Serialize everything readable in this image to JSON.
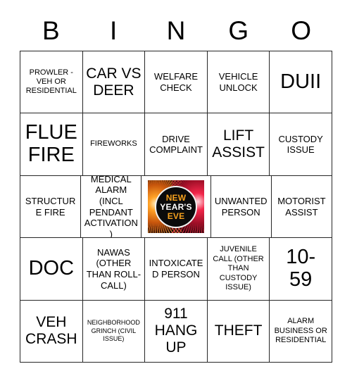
{
  "card": {
    "header_letters": [
      "B",
      "I",
      "N",
      "G",
      "O"
    ],
    "rows": [
      [
        {
          "text": "PROWLER - VEH OR RESIDENTIAL",
          "size": "sm",
          "type": "text"
        },
        {
          "text": "CAR VS DEER",
          "size": "lg",
          "type": "text"
        },
        {
          "text": "WELFARE CHECK",
          "size": "md",
          "type": "text"
        },
        {
          "text": "VEHICLE UNLOCK",
          "size": "md",
          "type": "text"
        },
        {
          "text": "DUII",
          "size": "xl",
          "type": "text"
        }
      ],
      [
        {
          "text": "FLUE FIRE",
          "size": "xl",
          "type": "text"
        },
        {
          "text": "FIREWORKS",
          "size": "sm",
          "type": "text"
        },
        {
          "text": "DRIVE COMPLAINT",
          "size": "md",
          "type": "text"
        },
        {
          "text": "LIFT ASSIST",
          "size": "lg",
          "type": "text"
        },
        {
          "text": "CUSTODY ISSUE",
          "size": "md",
          "type": "text"
        }
      ],
      [
        {
          "text": "STRUCTURE FIRE",
          "size": "md",
          "type": "text"
        },
        {
          "text": "MEDICAL ALARM (INCL PENDANT ACTIVATION)",
          "size": "md",
          "type": "text"
        },
        {
          "text": "",
          "size": "md",
          "type": "free_image"
        },
        {
          "text": "UNWANTED PERSON",
          "size": "md",
          "type": "text"
        },
        {
          "text": "MOTORIST ASSIST",
          "size": "md",
          "type": "text"
        }
      ],
      [
        {
          "text": "DOC",
          "size": "xl",
          "type": "text"
        },
        {
          "text": "NAWAS (OTHER THAN ROLL-CALL)",
          "size": "md",
          "type": "text"
        },
        {
          "text": "INTOXICATED PERSON",
          "size": "md",
          "type": "text"
        },
        {
          "text": "JUVENILE CALL (OTHER THAN CUSTODY ISSUE)",
          "size": "sm",
          "type": "text"
        },
        {
          "text": "10- 59",
          "size": "xl",
          "type": "text"
        }
      ],
      [
        {
          "text": "VEH CRASH",
          "size": "lg",
          "type": "text"
        },
        {
          "text": "NEIGHBORHOOD GRINCH (CIVIL ISSUE)",
          "size": "xs",
          "type": "text"
        },
        {
          "text": "911 HANG UP",
          "size": "lg",
          "type": "text"
        },
        {
          "text": "THEFT",
          "size": "lg",
          "type": "text"
        },
        {
          "text": "ALARM BUSINESS OR RESIDENTIAL",
          "size": "sm",
          "type": "text"
        }
      ]
    ]
  },
  "free_space": {
    "line1": "NEW",
    "line2": "YEAR'S",
    "line3": "EVE",
    "colors": {
      "accent": "#f5a11e",
      "text": "#ffffff",
      "disc": "#0b0b0b",
      "burst_left": "#ffa227",
      "burst_right": "#f2264a"
    }
  }
}
